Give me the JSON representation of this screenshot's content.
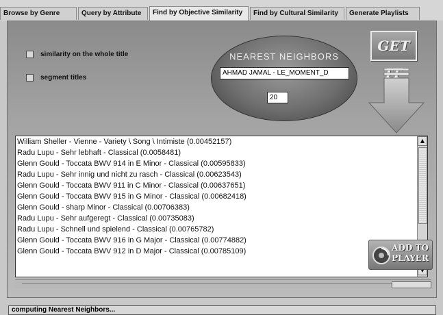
{
  "tabs": [
    {
      "label": "Browse by Genre"
    },
    {
      "label": "Query by Attribute"
    },
    {
      "label": "Find by Objective Similarity",
      "active": true
    },
    {
      "label": "Find by Cultural Similarity"
    },
    {
      "label": "Generate Playlists"
    }
  ],
  "options": {
    "whole_title": "similarity on the whole title",
    "segment_titles": "segment titles"
  },
  "nearest": {
    "title": "NEAREST NEIGHBORS",
    "query_value": "AHMAD JAMAL - LE_MOMENT_D",
    "count_value": "20"
  },
  "get_it_label": "GET IT",
  "results": [
    "William Sheller - Vienne - Variety \\ Song \\ Intimiste (0.00452157)",
    "Radu Lupu - Sehr lebhaft - Classical (0.0058481)",
    "Glenn Gould - Toccata BWV 914 in E Minor - Classical (0.00595833)",
    "Radu Lupu - Sehr innig und nicht zu rasch - Classical (0.00623543)",
    "Glenn Gould - Toccata BWV 911 in C Minor - Classical (0.00637651)",
    "Glenn Gould - Toccata BWV 915 in G Minor - Classical (0.00682418)",
    "Glenn Gould - sharp Minor - Classical (0.00706383)",
    "Radu Lupu - Sehr aufgeregt - Classical (0.00735083)",
    "Radu Lupu - Schnell und spielend - Classical (0.00765782)",
    "Glenn Gould - Toccata BWV 916 in G Major - Classical (0.00774882)",
    "Glenn Gould - Toccata BWV 912 in D Major - Classical (0.00785109)"
  ],
  "add_to_player": {
    "line1": "ADD TO",
    "line2": "PLAYER"
  },
  "status_text": "computing Nearest Neighbors..."
}
